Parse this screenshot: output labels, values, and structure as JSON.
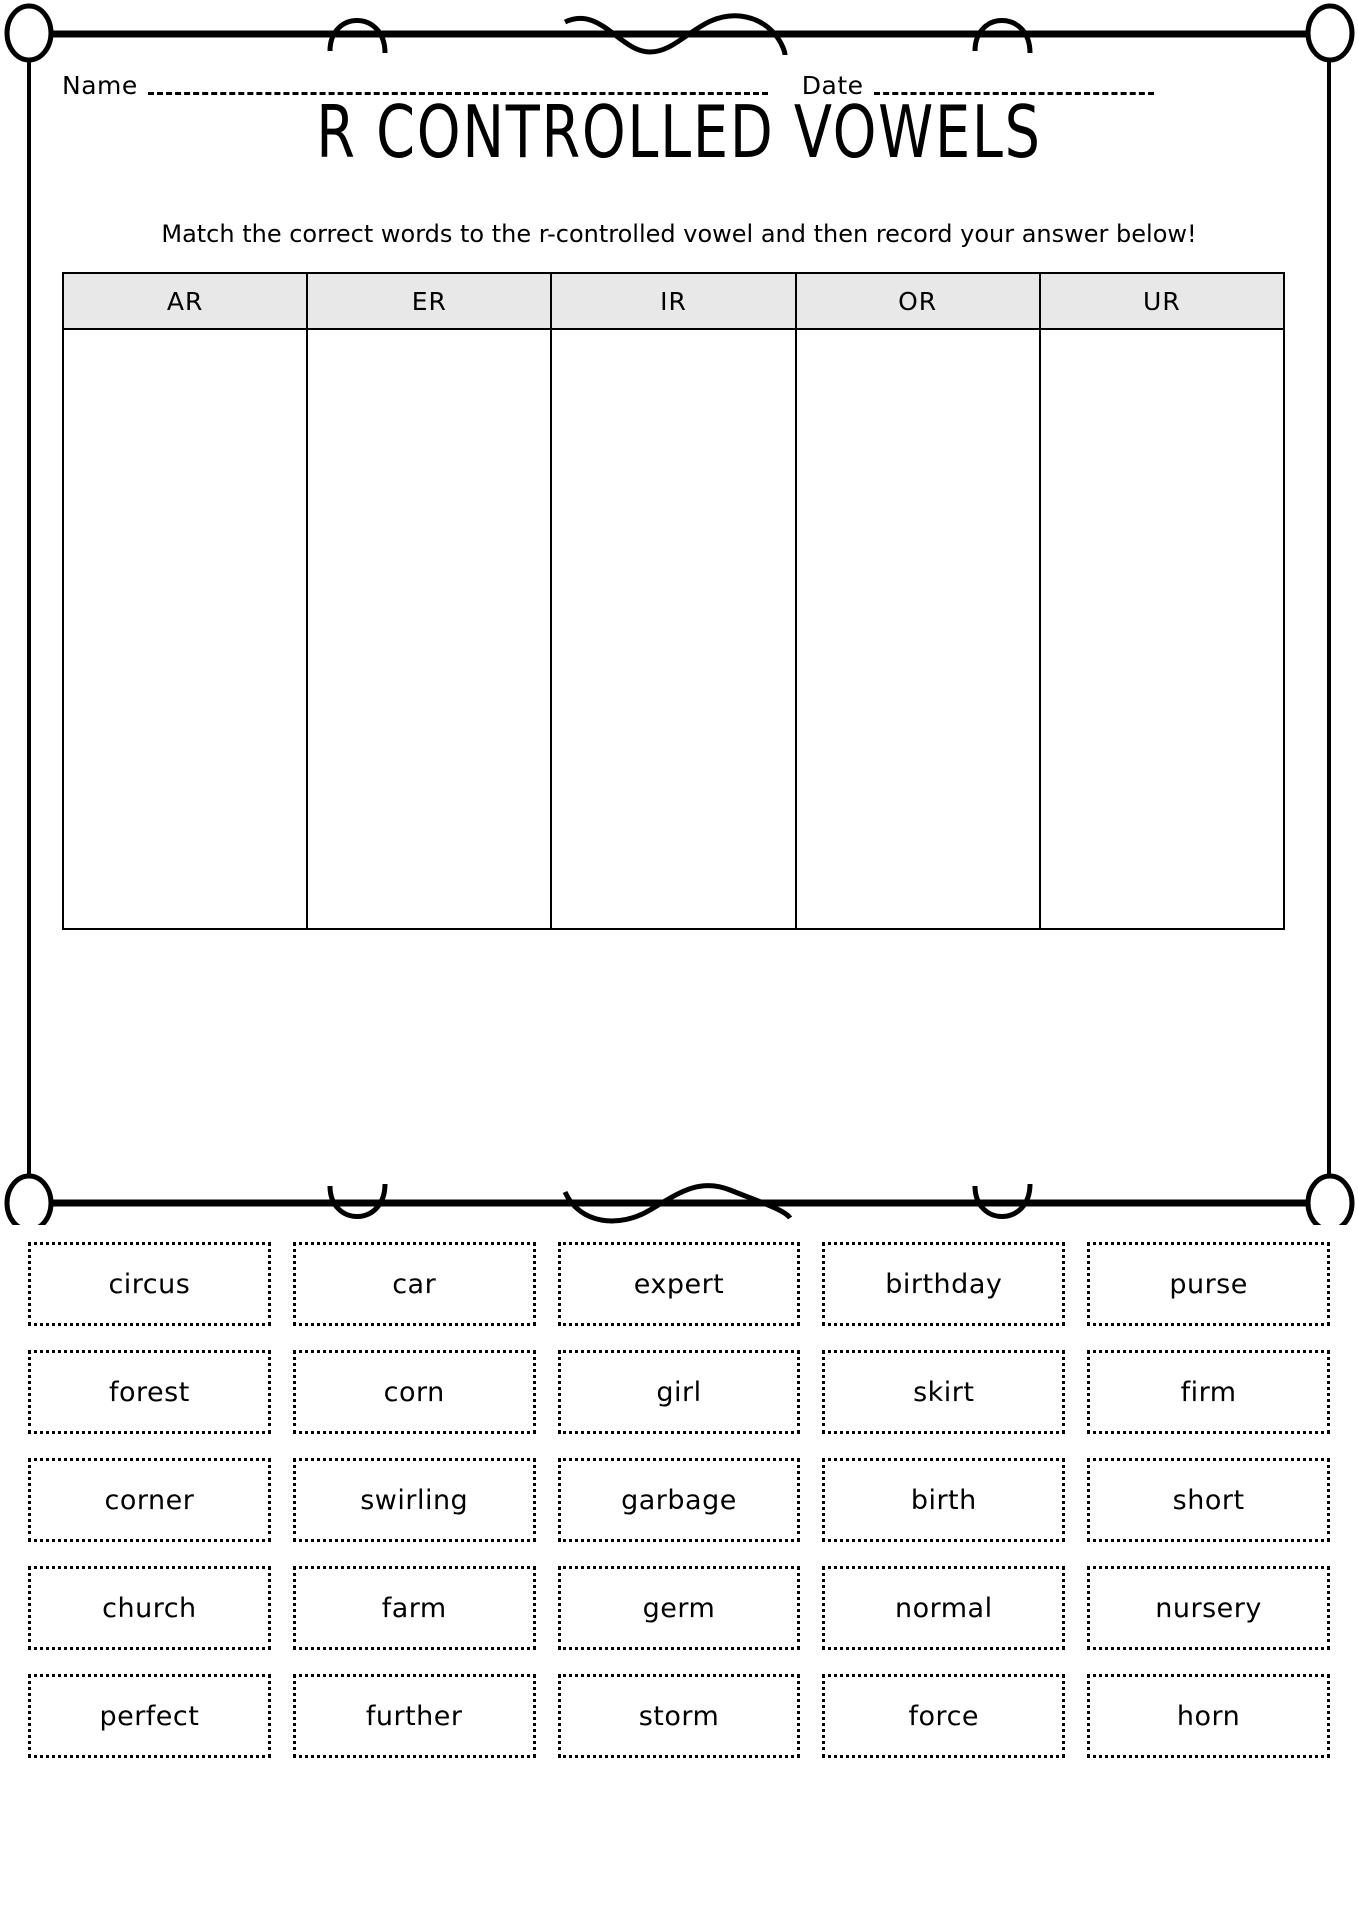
{
  "worksheet": {
    "title": "R CONTROLLED VOWELS",
    "subtitle": "Match the correct words to the r-controlled vowel and then record your answer below!",
    "name_label": "Name",
    "date_label": "Date",
    "name_value": "",
    "date_value": "",
    "name_placeholder": "",
    "date_placeholder": ""
  },
  "sort_table": {
    "columns": [
      {
        "header": "AR",
        "entries": []
      },
      {
        "header": "ER",
        "entries": []
      },
      {
        "header": "IR",
        "entries": []
      },
      {
        "header": "OR",
        "entries": []
      },
      {
        "header": "UR",
        "entries": []
      }
    ],
    "header_fill": "#e8e8e8",
    "border_color": "#000000"
  },
  "word_bank": {
    "rows": [
      {
        "cells": [
          {
            "word": "circus"
          },
          {
            "word": "car"
          },
          {
            "word": "expert"
          },
          {
            "word": "birthday"
          },
          {
            "word": "purse"
          }
        ]
      },
      {
        "cells": [
          {
            "word": "forest"
          },
          {
            "word": "corn"
          },
          {
            "word": "girl"
          },
          {
            "word": "skirt"
          },
          {
            "word": "firm"
          }
        ]
      },
      {
        "cells": [
          {
            "word": "corner"
          },
          {
            "word": "swirling"
          },
          {
            "word": "garbage"
          },
          {
            "word": "birth"
          },
          {
            "word": "short"
          }
        ]
      },
      {
        "cells": [
          {
            "word": "church"
          },
          {
            "word": "farm"
          },
          {
            "word": "germ"
          },
          {
            "word": "normal"
          },
          {
            "word": "nursery"
          }
        ]
      },
      {
        "cells": [
          {
            "word": "perfect"
          },
          {
            "word": "further"
          },
          {
            "word": "storm"
          },
          {
            "word": "force"
          },
          {
            "word": "horn"
          }
        ]
      }
    ]
  },
  "decor": {
    "frame_style": "hand-drawn-rectangle-with-corner-circles",
    "stroke_color": "#000000"
  }
}
